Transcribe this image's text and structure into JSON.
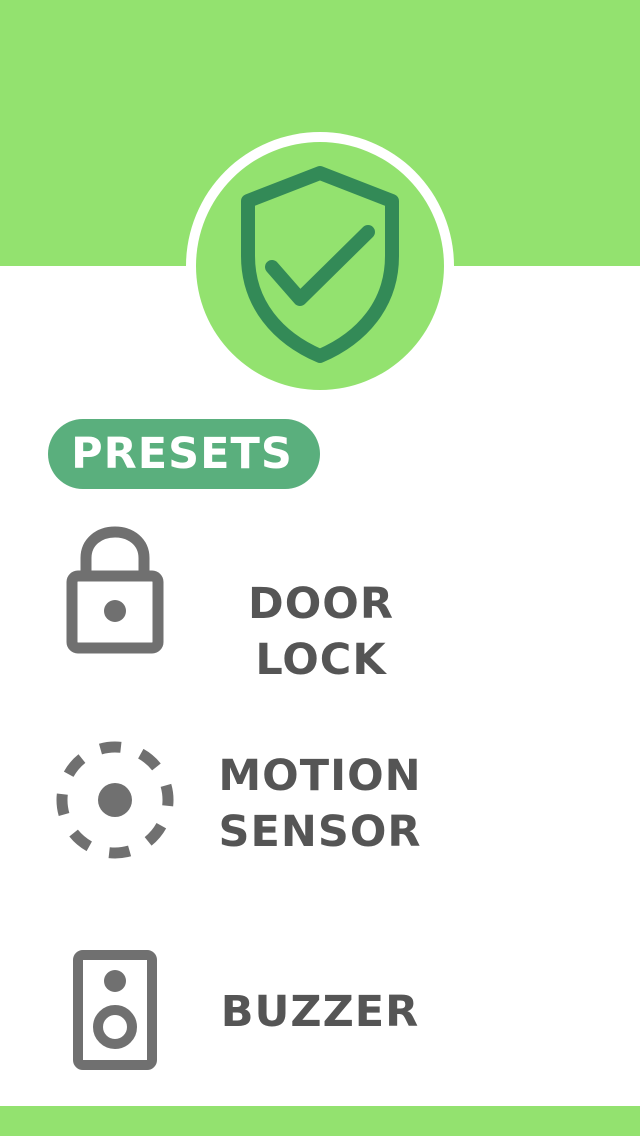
{
  "colors": {
    "banner": "#93e26f",
    "shield": "#338a57",
    "pill": "#5aaf7d",
    "icon": "#707070",
    "label": "#555555",
    "background": "#ffffff"
  },
  "header": {
    "logo_icon": "shield-check-icon"
  },
  "presets": {
    "title": "PRESETS",
    "items": [
      {
        "icon": "lock-icon",
        "label": "DOOR LOCK"
      },
      {
        "icon": "motion-sensor-icon",
        "label": "MOTION\nSENSOR"
      },
      {
        "icon": "speaker-icon",
        "label": "BUZZER"
      }
    ]
  }
}
